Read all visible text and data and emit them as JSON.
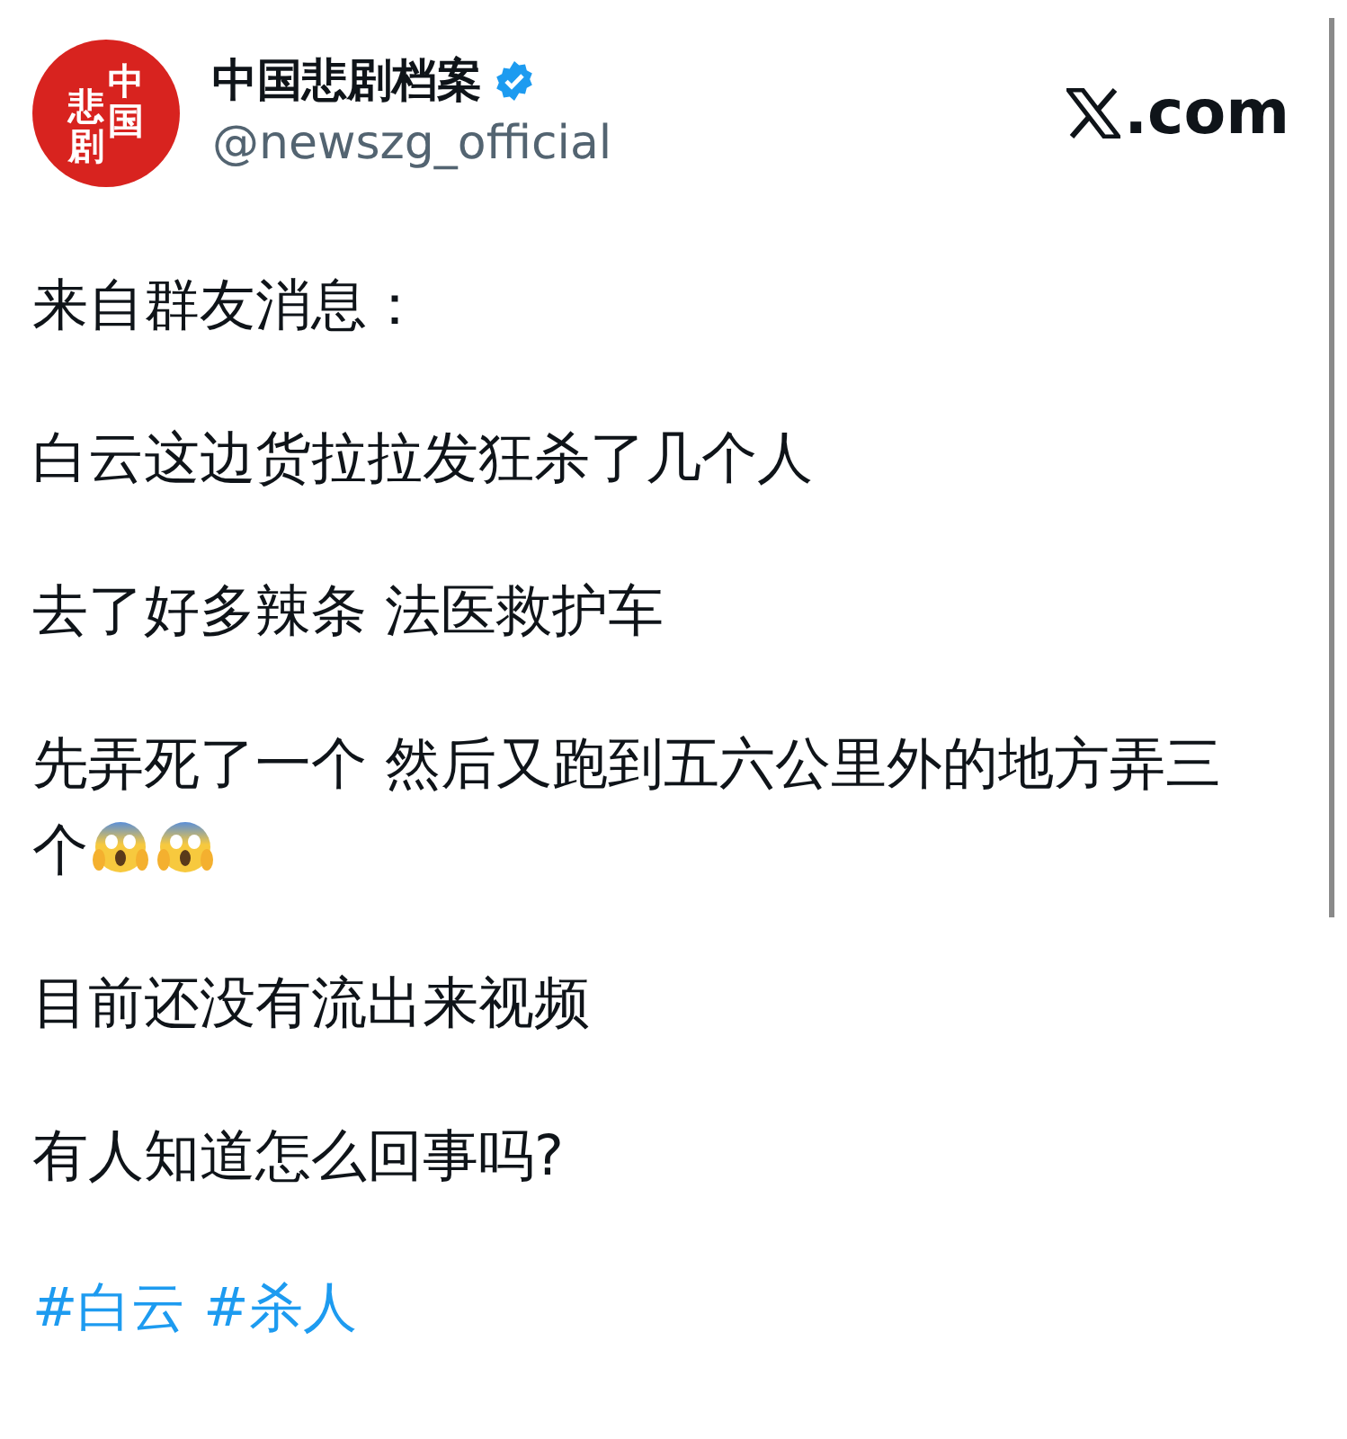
{
  "header": {
    "avatar": {
      "column_right": "中国",
      "column_left": "悲剧"
    },
    "display_name": "中国悲剧档案",
    "verified": true,
    "handle": "@newszg_official",
    "site": ".com"
  },
  "paragraphs": [
    {
      "text": "来自群友消息："
    },
    {
      "text": "白云这边货拉拉发狂杀了几个人"
    },
    {
      "text": "去了好多辣条 法医救护车"
    },
    {
      "text": "先弄死了一个 然后又跑到五六公里外的地方弄三个",
      "trailing_icons": [
        {
          "kind": "scream"
        },
        {
          "kind": "scream"
        }
      ]
    },
    {
      "text": "目前还没有流出来视频"
    },
    {
      "text": "有人知道怎么回事吗?"
    }
  ],
  "hashtags": [
    "#白云",
    "#杀人"
  ]
}
